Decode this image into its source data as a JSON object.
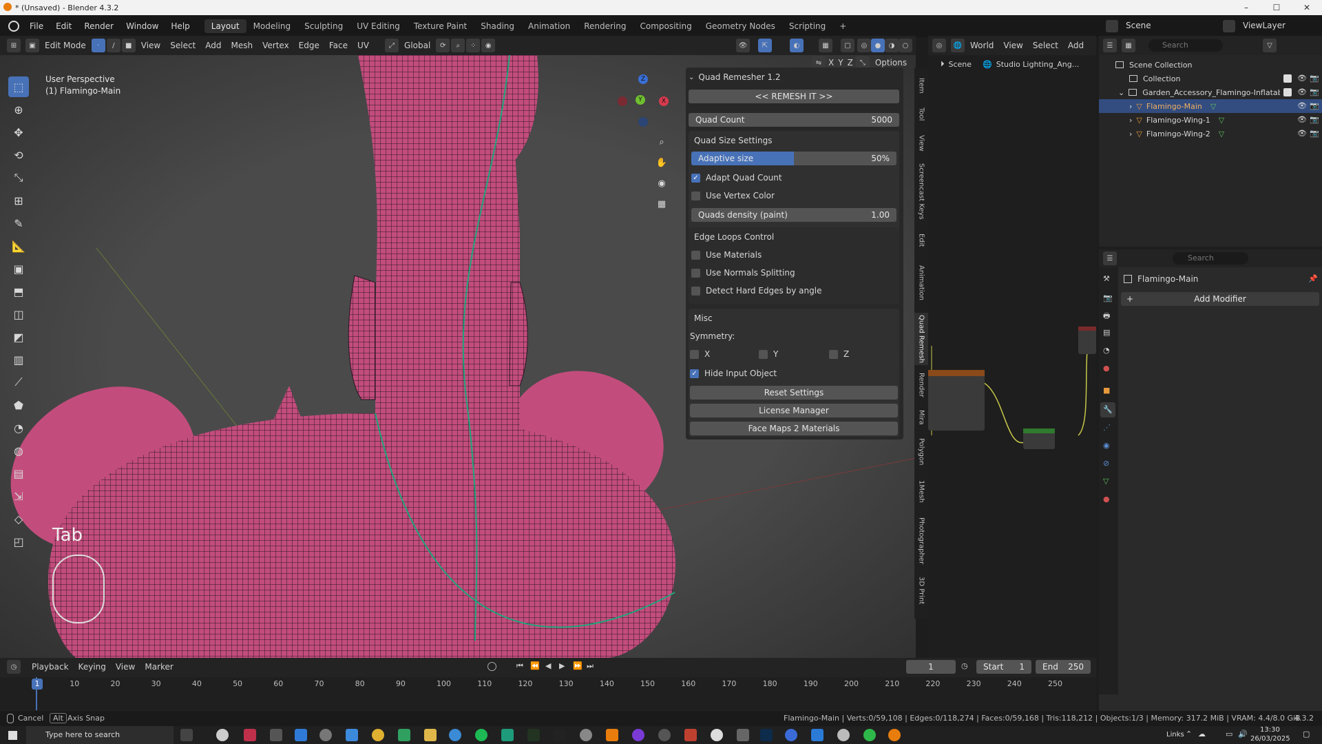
{
  "window": {
    "title": "* (Unsaved) - Blender 4.3.2",
    "minimize": "–",
    "maximize": "☐",
    "close": "✕"
  },
  "menubar": {
    "menus": [
      "File",
      "Edit",
      "Render",
      "Window",
      "Help"
    ],
    "workspaces": [
      "Layout",
      "Modeling",
      "Sculpting",
      "UV Editing",
      "Texture Paint",
      "Shading",
      "Animation",
      "Rendering",
      "Compositing",
      "Geometry Nodes",
      "Scripting"
    ],
    "active_workspace": "Layout",
    "add_tab": "+",
    "scene": "Scene",
    "view_layer": "ViewLayer"
  },
  "header3d": {
    "mode": "Edit Mode",
    "menus": [
      "View",
      "Select",
      "Add",
      "Mesh",
      "Vertex",
      "Edge",
      "Face",
      "UV"
    ],
    "transform_orientation": "Global",
    "options": "Options",
    "axes": [
      "X",
      "Y",
      "Z"
    ]
  },
  "viewport": {
    "perspective": "User Perspective",
    "object": "(1) Flamingo-Main",
    "key_overlay": "Tab",
    "gizmo": {
      "x": "X",
      "y": "Y",
      "z": "Z"
    }
  },
  "quad_remesher": {
    "title": "Quad Remesher 1.2",
    "remesh_button": "<< REMESH IT >>",
    "quad_count_label": "Quad Count",
    "quad_count_value": "5000",
    "quad_size_settings": "Quad Size Settings",
    "adaptive_size_label": "Adaptive size",
    "adaptive_size_value": "50%",
    "adaptive_size_fraction": 0.5,
    "adapt_quad_count": "Adapt Quad Count",
    "use_vertex_color": "Use Vertex Color",
    "quads_density_label": "Quads density (paint)",
    "quads_density_value": "1.00",
    "edge_loops_control": "Edge Loops Control",
    "use_materials": "Use Materials",
    "use_normals_splitting": "Use Normals Splitting",
    "detect_hard_edges": "Detect Hard Edges by angle",
    "misc": "Misc",
    "symmetry": "Symmetry:",
    "sym_x": "X",
    "sym_y": "Y",
    "sym_z": "Z",
    "hide_input_object": "Hide Input Object",
    "reset_settings": "Reset Settings",
    "license_manager": "License Manager",
    "face_maps_2_materials": "Face Maps 2 Materials"
  },
  "sidebar_tabs": [
    "Item",
    "Tool",
    "View",
    "Screencast Keys",
    "Edit",
    "Animation",
    "Quad Remesh",
    "Render",
    "Mira",
    "Polygon",
    "1Mesh",
    "Photographer",
    "3D Print"
  ],
  "node_editor": {
    "view": "View",
    "select": "Select",
    "add": "Add",
    "world": "World",
    "breadcrumb_scene": "Scene",
    "breadcrumb_world": "Studio Lighting_Ang..."
  },
  "outliner": {
    "search_placeholder": "Search",
    "scene_collection": "Scene Collection",
    "collection": "Collection",
    "garden": "Garden_Accessory_Flamingo-Inflatable_",
    "objects": [
      "Flamingo-Main",
      "Flamingo-Wing-1",
      "Flamingo-Wing-2"
    ]
  },
  "properties": {
    "search_placeholder": "Search",
    "object_name": "Flamingo-Main",
    "add_modifier": "Add Modifier"
  },
  "timeline": {
    "menus": [
      "Playback",
      "Keying",
      "View",
      "Marker"
    ],
    "current_frame": "1",
    "start_label": "Start",
    "start_value": "1",
    "end_label": "End",
    "end_value": "250",
    "ticks": [
      "1",
      "10",
      "20",
      "30",
      "40",
      "50",
      "60",
      "70",
      "80",
      "90",
      "100",
      "110",
      "120",
      "130",
      "140",
      "150",
      "160",
      "170",
      "180",
      "190",
      "200",
      "210",
      "220",
      "230",
      "240",
      "250"
    ]
  },
  "statusbar": {
    "cancel": "Cancel",
    "alt": "Alt",
    "axis_snap": "Axis Snap",
    "stats": "Flamingo-Main | Verts:0/59,108 | Edges:0/118,274 | Faces:0/59,168 | Tris:118,212 | Objects:1/3 | Memory: 317.2 MiB | VRAM: 4.4/8.0 GiB",
    "version": "4.3.2"
  },
  "taskbar": {
    "search_placeholder": "Type here to search",
    "links": "Links",
    "time": "13:30",
    "date": "26/03/2025"
  },
  "colors": {
    "accent": "#4872b8",
    "mesh": "#c24d7c",
    "wire": "#2b1523",
    "seam": "#1fa67a"
  }
}
